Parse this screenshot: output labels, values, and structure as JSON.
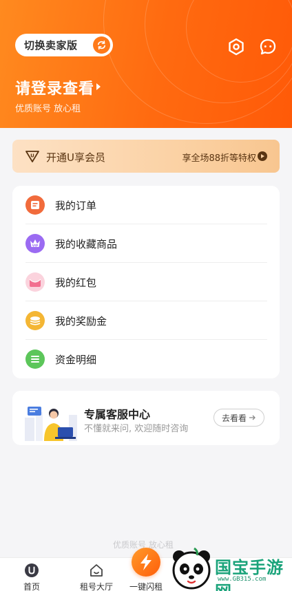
{
  "header": {
    "switch_label": "切换卖家版",
    "settings_icon": "settings-hexagon-icon",
    "message_icon": "chat-bubble-icon",
    "login_title": "请登录查看",
    "login_subtitle": "优质账号 放心租"
  },
  "vip": {
    "label": "开通U享会员",
    "right_text": "享全场88折等特权"
  },
  "menu": {
    "items": [
      {
        "label": "我的订单",
        "icon": "order-icon",
        "color": "#f16b3c"
      },
      {
        "label": "我的收藏商品",
        "icon": "vip-favorite-icon",
        "color": "#9b6bf2"
      },
      {
        "label": "我的红包",
        "icon": "red-packet-icon",
        "color": "#f58aa4"
      },
      {
        "label": "我的奖励金",
        "icon": "coin-stack-icon",
        "color": "#f4b634"
      },
      {
        "label": "资金明细",
        "icon": "funds-detail-icon",
        "color": "#5cc65a"
      }
    ]
  },
  "service": {
    "title": "专属客服中心",
    "subtitle": "不懂就来问, 欢迎随时咨询",
    "button": "去看看"
  },
  "footer_faded_text": "优质账号 放心租",
  "tabbar": {
    "tabs": [
      {
        "label": "首页",
        "icon": "home-u-icon"
      },
      {
        "label": "租号大厅",
        "icon": "hall-house-icon"
      },
      {
        "label": "一键闪租",
        "icon": "lightning-icon"
      }
    ]
  },
  "watermark": {
    "brand": "国宝手游网",
    "url": "www.GB315.com"
  },
  "colors": {
    "header_orange": "#ff6a10",
    "accent": "#ff7a1a",
    "vip_gold": "#fbd2a5",
    "watermark_green": "#1aa37a"
  }
}
